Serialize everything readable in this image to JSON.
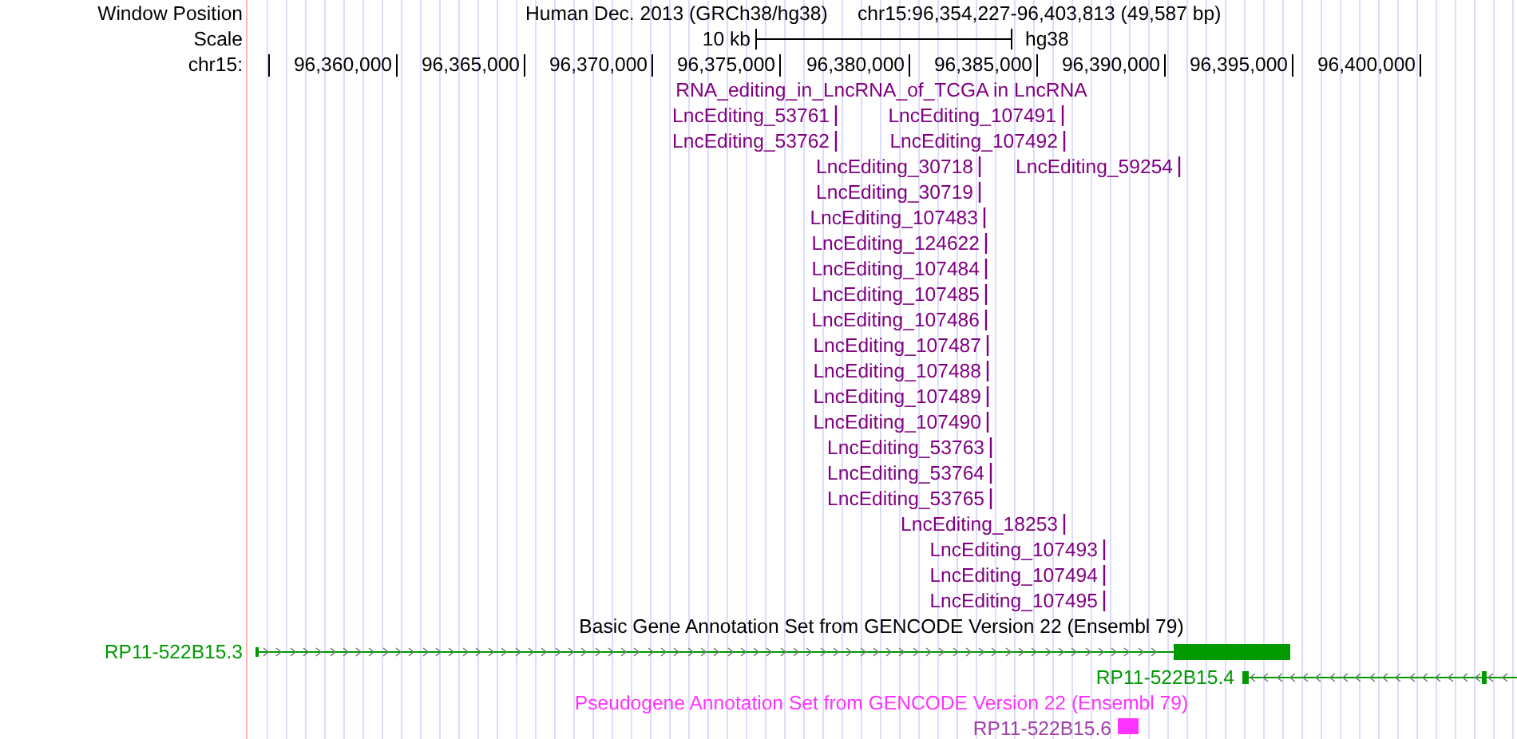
{
  "position_row": {
    "label": "Window Position",
    "assembly": "Human Dec. 2013 (GRCh38/hg38)",
    "position": "chr15:96,354,227-96,403,813 (49,587 bp)"
  },
  "scale_row": {
    "label": "Scale",
    "scale": "10 kb",
    "assembly_name": "hg38"
  },
  "ruler": {
    "label": "chr15:",
    "ticks": [
      "96,360,000",
      "96,365,000",
      "96,370,000",
      "96,375,000",
      "96,380,000",
      "96,385,000",
      "96,390,000",
      "96,395,000",
      "96,400,000"
    ]
  },
  "tracks": [
    {
      "kind": "editing",
      "title": "RNA_editing_in_LncRNA_of_TCGA in LncRNA",
      "rows": [
        [
          "LncEditing_53761",
          "LncEditing_107491"
        ],
        [
          "LncEditing_53762",
          "LncEditing_107492"
        ],
        [
          "LncEditing_30718",
          "LncEditing_59254"
        ],
        [
          "LncEditing_30719"
        ],
        [
          "LncEditing_107483"
        ],
        [
          "LncEditing_124622"
        ],
        [
          "LncEditing_107484"
        ],
        [
          "LncEditing_107485"
        ],
        [
          "LncEditing_107486"
        ],
        [
          "LncEditing_107487"
        ],
        [
          "LncEditing_107488"
        ],
        [
          "LncEditing_107489"
        ],
        [
          "LncEditing_107490"
        ],
        [
          "LncEditing_53763"
        ],
        [
          "LncEditing_53764"
        ],
        [
          "LncEditing_53765"
        ],
        [
          "LncEditing_18253"
        ],
        [
          "LncEditing_107493"
        ],
        [
          "LncEditing_107494"
        ],
        [
          "LncEditing_107495"
        ]
      ]
    },
    {
      "kind": "gene",
      "title": "Basic Gene Annotation Set from GENCODE Version 22 (Ensembl 79)",
      "genes": [
        {
          "name": "RP11-522B15.3",
          "reverse_strand": false
        },
        {
          "name": "RP11-522B15.4",
          "reverse_strand": true
        }
      ]
    },
    {
      "kind": "pseudogene",
      "title": "Pseudogene Annotation Set from GENCODE Version 22 (Ensembl 79)",
      "genes": [
        {
          "name": "RP11-522B15.6"
        }
      ]
    }
  ]
}
